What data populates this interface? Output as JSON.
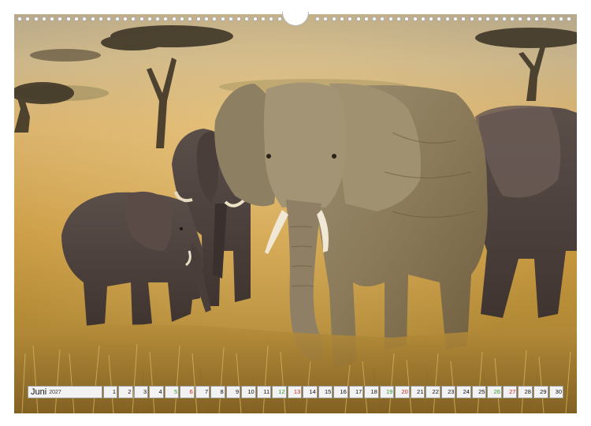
{
  "calendar": {
    "month": "Juni",
    "year": "2027",
    "days": [
      {
        "n": "1",
        "t": "w"
      },
      {
        "n": "2",
        "t": "w"
      },
      {
        "n": "3",
        "t": "w"
      },
      {
        "n": "4",
        "t": "w"
      },
      {
        "n": "5",
        "t": "sat"
      },
      {
        "n": "6",
        "t": "sun"
      },
      {
        "n": "7",
        "t": "w"
      },
      {
        "n": "8",
        "t": "w"
      },
      {
        "n": "9",
        "t": "w"
      },
      {
        "n": "10",
        "t": "w"
      },
      {
        "n": "11",
        "t": "w"
      },
      {
        "n": "12",
        "t": "sat"
      },
      {
        "n": "13",
        "t": "sun"
      },
      {
        "n": "14",
        "t": "w"
      },
      {
        "n": "15",
        "t": "w"
      },
      {
        "n": "16",
        "t": "w"
      },
      {
        "n": "17",
        "t": "w"
      },
      {
        "n": "18",
        "t": "w"
      },
      {
        "n": "19",
        "t": "sat"
      },
      {
        "n": "20",
        "t": "sun"
      },
      {
        "n": "21",
        "t": "w"
      },
      {
        "n": "22",
        "t": "w"
      },
      {
        "n": "23",
        "t": "w"
      },
      {
        "n": "24",
        "t": "w"
      },
      {
        "n": "25",
        "t": "w"
      },
      {
        "n": "26",
        "t": "sat"
      },
      {
        "n": "27",
        "t": "sun"
      },
      {
        "n": "28",
        "t": "w"
      },
      {
        "n": "29",
        "t": "w"
      },
      {
        "n": "30",
        "t": "w"
      }
    ],
    "colors": {
      "saturday": "#2e9a2e",
      "sunday": "#d22020"
    }
  },
  "photo": {
    "subject": "elephant-herd",
    "icon": "elephant-photo"
  }
}
